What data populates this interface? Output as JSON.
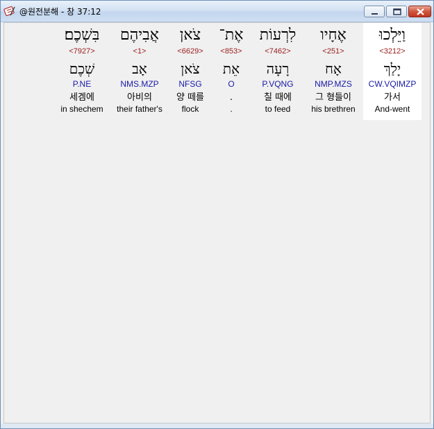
{
  "window": {
    "title": "@원전분해 - 창 37:12",
    "app_icon": "book-pen-icon",
    "controls": [
      "minimize-icon",
      "maximize-icon",
      "close-icon"
    ],
    "accent": "#c2371f"
  },
  "colors": {
    "strong": "#9b1c1c",
    "parse": "#1a1aa8",
    "highlight": "#ffffff"
  },
  "words": [
    {
      "hebrew": "וַיֵּלְכוּ",
      "strong": "<3212>",
      "lemma": "יָלַךְ",
      "parse": "CW.VQIMZP",
      "korean": "가서",
      "english": "And-went"
    },
    {
      "hebrew": "אֶחָיו",
      "strong": "<251>",
      "lemma": "אָח",
      "parse": "NMP.MZS",
      "korean": "그 형들이",
      "english": "his brethren"
    },
    {
      "hebrew": "לִרְעוֹת",
      "strong": "<7462>",
      "lemma": "רָעָה",
      "parse": "P.VQNG",
      "korean": "칠 때에",
      "english": "to feed"
    },
    {
      "hebrew": "אֶת־",
      "strong": "<853>",
      "lemma": "אֵת",
      "parse": "O",
      "korean": ".",
      "english": "."
    },
    {
      "hebrew": "צֹאן",
      "strong": "<6629>",
      "lemma": "צֹאן",
      "parse": "NFSG",
      "korean": "양 떼를",
      "english": "flock"
    },
    {
      "hebrew": "אֲבִיהֶם",
      "strong": "<1>",
      "lemma": "אָב",
      "parse": "NMS.MZP",
      "korean": "아비의",
      "english": "their father's"
    },
    {
      "hebrew": "בִּשְׁכֶם׃",
      "strong": "<7927>",
      "lemma": "שְׁכֶם",
      "parse": "P.NE",
      "korean": "세겜에",
      "english": "in shechem"
    }
  ]
}
